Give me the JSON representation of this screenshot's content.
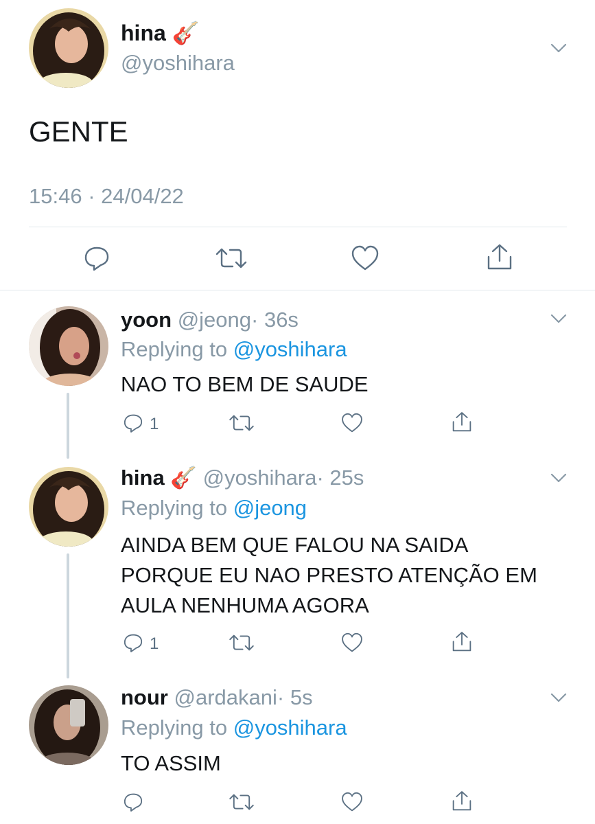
{
  "main_tweet": {
    "author_name": "hina",
    "author_emoji": "🎸",
    "handle": "@yoshihara",
    "text": "GENTE",
    "timestamp": "15:46 · 24/04/22"
  },
  "replies": [
    {
      "name": "yoon",
      "handle": "@jeong",
      "time": "· 36s",
      "replying_label": "Replying to",
      "replying_to": "@yoshihara",
      "text": "NAO TO BEM DE SAUDE",
      "reply_count": "1"
    },
    {
      "name": "hina",
      "emoji": "🎸",
      "handle": "@yoshihara",
      "time": "· 25s",
      "replying_label": "Replying to",
      "replying_to": "@jeong",
      "text_lines": [
        "AINDA BEM QUE FALOU NA SAIDA",
        "PORQUE EU NAO PRESTO ATENÇÃO EM",
        "AULA NENHUMA AGORA"
      ],
      "reply_count": "1"
    },
    {
      "name": "nour",
      "handle": "@ardakani",
      "time": "· 5s",
      "replying_label": "Replying to",
      "replying_to": "@yoshihara",
      "text": "TO ASSIM"
    }
  ],
  "icons": {
    "reply": "reply-icon",
    "retweet": "retweet-icon",
    "like": "heart-icon",
    "share": "share-icon",
    "more": "chevron-down-icon"
  },
  "colors": {
    "link": "#1b95e0",
    "muted": "#8899a6",
    "icon": "#5b7083",
    "text": "#14171a"
  }
}
